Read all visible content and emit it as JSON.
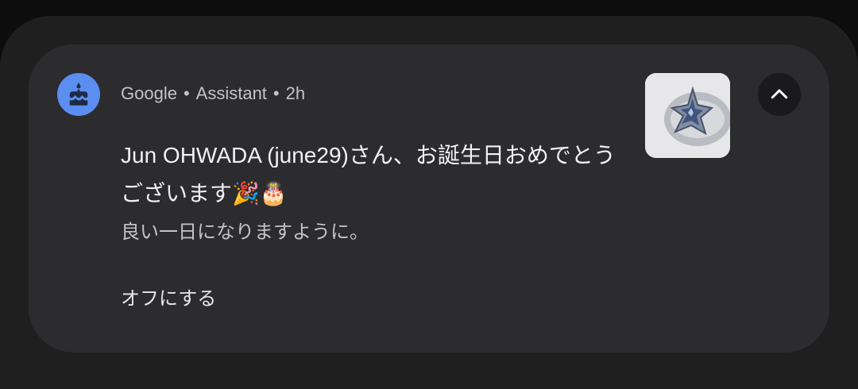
{
  "notification": {
    "app_name": "Google",
    "sub_app": "Assistant",
    "separator": "•",
    "time": "2h",
    "title": "Jun OHWADA (june29)さん、お誕生日おめでとうございます🎉🎂",
    "body": "良い一日になりますように。",
    "action_label": "オフにする",
    "icons": {
      "app": "birthday-cake-icon",
      "thumbnail": "star-ring-image",
      "collapse": "chevron-up-icon"
    },
    "colors": {
      "app_icon_bg": "#5b8ef0",
      "card_bg": "#2c2c2f"
    }
  }
}
